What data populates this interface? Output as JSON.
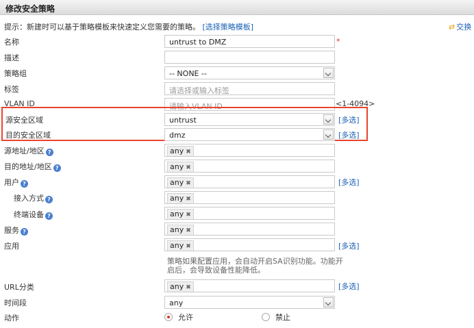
{
  "title": "修改安全策略",
  "hint": {
    "text": "提示：新建时可以基于策略模板来快速定义您需要的策略。",
    "link": "[选择策略模板]"
  },
  "swap": {
    "label": "交换"
  },
  "required_mark": "*",
  "fields": {
    "name": {
      "label": "名称",
      "value": "untrust to DMZ"
    },
    "desc": {
      "label": "描述",
      "value": ""
    },
    "group": {
      "label": "策略组",
      "value": "-- NONE --"
    },
    "tag": {
      "label": "标签",
      "placeholder": "请选择或输入标签"
    },
    "vlan": {
      "label": "VLAN ID",
      "placeholder": "请输入VLAN ID",
      "range": "<1-4094>"
    },
    "src_zone": {
      "label": "源安全区域",
      "value": "untrust",
      "multi": "[多选]"
    },
    "dst_zone": {
      "label": "目的安全区域",
      "value": "dmz",
      "multi": "[多选]"
    },
    "src_addr": {
      "label": "源地址/地区",
      "value": "any"
    },
    "dst_addr": {
      "label": "目的地址/地区",
      "value": "any"
    },
    "user": {
      "label": "用户",
      "value": "any",
      "multi": "[多选]"
    },
    "access": {
      "label": "接入方式",
      "value": "any"
    },
    "terminal": {
      "label": "终端设备",
      "value": "any"
    },
    "service": {
      "label": "服务",
      "value": "any"
    },
    "app": {
      "label": "应用",
      "value": "any",
      "multi": "[多选]",
      "note": "策略如果配置应用，会自动开启SA识别功能。功能开启后，会导致设备性能降低。"
    },
    "url": {
      "label": "URL分类",
      "value": "any",
      "multi": "[多选]"
    },
    "time": {
      "label": "时间段",
      "value": "any"
    },
    "action": {
      "label": "动作",
      "options": [
        "允许",
        "禁止"
      ],
      "selected": "允许"
    }
  }
}
